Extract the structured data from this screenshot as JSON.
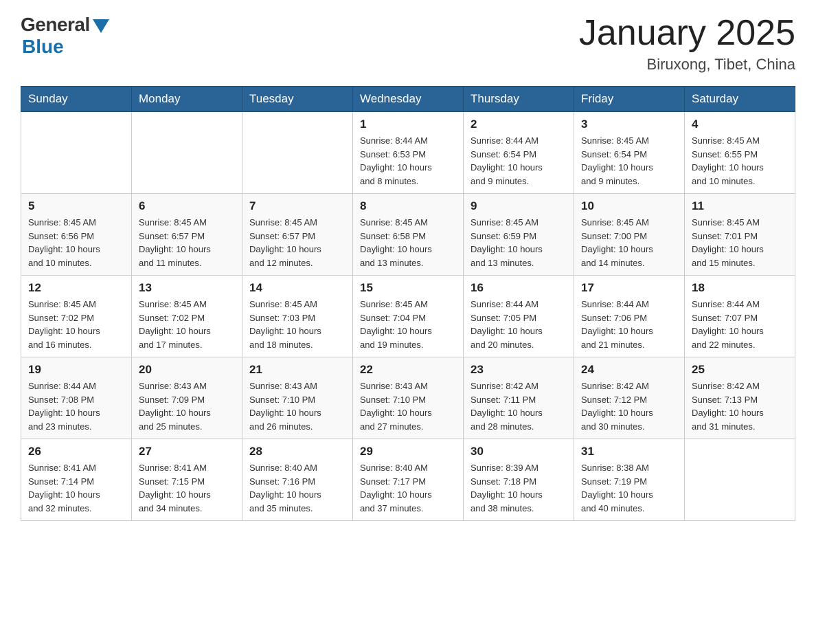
{
  "header": {
    "logo_general": "General",
    "logo_blue": "Blue",
    "month_title": "January 2025",
    "location": "Biruxong, Tibet, China"
  },
  "days_of_week": [
    "Sunday",
    "Monday",
    "Tuesday",
    "Wednesday",
    "Thursday",
    "Friday",
    "Saturday"
  ],
  "weeks": [
    [
      {
        "day": "",
        "info": ""
      },
      {
        "day": "",
        "info": ""
      },
      {
        "day": "",
        "info": ""
      },
      {
        "day": "1",
        "info": "Sunrise: 8:44 AM\nSunset: 6:53 PM\nDaylight: 10 hours\nand 8 minutes."
      },
      {
        "day": "2",
        "info": "Sunrise: 8:44 AM\nSunset: 6:54 PM\nDaylight: 10 hours\nand 9 minutes."
      },
      {
        "day": "3",
        "info": "Sunrise: 8:45 AM\nSunset: 6:54 PM\nDaylight: 10 hours\nand 9 minutes."
      },
      {
        "day": "4",
        "info": "Sunrise: 8:45 AM\nSunset: 6:55 PM\nDaylight: 10 hours\nand 10 minutes."
      }
    ],
    [
      {
        "day": "5",
        "info": "Sunrise: 8:45 AM\nSunset: 6:56 PM\nDaylight: 10 hours\nand 10 minutes."
      },
      {
        "day": "6",
        "info": "Sunrise: 8:45 AM\nSunset: 6:57 PM\nDaylight: 10 hours\nand 11 minutes."
      },
      {
        "day": "7",
        "info": "Sunrise: 8:45 AM\nSunset: 6:57 PM\nDaylight: 10 hours\nand 12 minutes."
      },
      {
        "day": "8",
        "info": "Sunrise: 8:45 AM\nSunset: 6:58 PM\nDaylight: 10 hours\nand 13 minutes."
      },
      {
        "day": "9",
        "info": "Sunrise: 8:45 AM\nSunset: 6:59 PM\nDaylight: 10 hours\nand 13 minutes."
      },
      {
        "day": "10",
        "info": "Sunrise: 8:45 AM\nSunset: 7:00 PM\nDaylight: 10 hours\nand 14 minutes."
      },
      {
        "day": "11",
        "info": "Sunrise: 8:45 AM\nSunset: 7:01 PM\nDaylight: 10 hours\nand 15 minutes."
      }
    ],
    [
      {
        "day": "12",
        "info": "Sunrise: 8:45 AM\nSunset: 7:02 PM\nDaylight: 10 hours\nand 16 minutes."
      },
      {
        "day": "13",
        "info": "Sunrise: 8:45 AM\nSunset: 7:02 PM\nDaylight: 10 hours\nand 17 minutes."
      },
      {
        "day": "14",
        "info": "Sunrise: 8:45 AM\nSunset: 7:03 PM\nDaylight: 10 hours\nand 18 minutes."
      },
      {
        "day": "15",
        "info": "Sunrise: 8:45 AM\nSunset: 7:04 PM\nDaylight: 10 hours\nand 19 minutes."
      },
      {
        "day": "16",
        "info": "Sunrise: 8:44 AM\nSunset: 7:05 PM\nDaylight: 10 hours\nand 20 minutes."
      },
      {
        "day": "17",
        "info": "Sunrise: 8:44 AM\nSunset: 7:06 PM\nDaylight: 10 hours\nand 21 minutes."
      },
      {
        "day": "18",
        "info": "Sunrise: 8:44 AM\nSunset: 7:07 PM\nDaylight: 10 hours\nand 22 minutes."
      }
    ],
    [
      {
        "day": "19",
        "info": "Sunrise: 8:44 AM\nSunset: 7:08 PM\nDaylight: 10 hours\nand 23 minutes."
      },
      {
        "day": "20",
        "info": "Sunrise: 8:43 AM\nSunset: 7:09 PM\nDaylight: 10 hours\nand 25 minutes."
      },
      {
        "day": "21",
        "info": "Sunrise: 8:43 AM\nSunset: 7:10 PM\nDaylight: 10 hours\nand 26 minutes."
      },
      {
        "day": "22",
        "info": "Sunrise: 8:43 AM\nSunset: 7:10 PM\nDaylight: 10 hours\nand 27 minutes."
      },
      {
        "day": "23",
        "info": "Sunrise: 8:42 AM\nSunset: 7:11 PM\nDaylight: 10 hours\nand 28 minutes."
      },
      {
        "day": "24",
        "info": "Sunrise: 8:42 AM\nSunset: 7:12 PM\nDaylight: 10 hours\nand 30 minutes."
      },
      {
        "day": "25",
        "info": "Sunrise: 8:42 AM\nSunset: 7:13 PM\nDaylight: 10 hours\nand 31 minutes."
      }
    ],
    [
      {
        "day": "26",
        "info": "Sunrise: 8:41 AM\nSunset: 7:14 PM\nDaylight: 10 hours\nand 32 minutes."
      },
      {
        "day": "27",
        "info": "Sunrise: 8:41 AM\nSunset: 7:15 PM\nDaylight: 10 hours\nand 34 minutes."
      },
      {
        "day": "28",
        "info": "Sunrise: 8:40 AM\nSunset: 7:16 PM\nDaylight: 10 hours\nand 35 minutes."
      },
      {
        "day": "29",
        "info": "Sunrise: 8:40 AM\nSunset: 7:17 PM\nDaylight: 10 hours\nand 37 minutes."
      },
      {
        "day": "30",
        "info": "Sunrise: 8:39 AM\nSunset: 7:18 PM\nDaylight: 10 hours\nand 38 minutes."
      },
      {
        "day": "31",
        "info": "Sunrise: 8:38 AM\nSunset: 7:19 PM\nDaylight: 10 hours\nand 40 minutes."
      },
      {
        "day": "",
        "info": ""
      }
    ]
  ]
}
